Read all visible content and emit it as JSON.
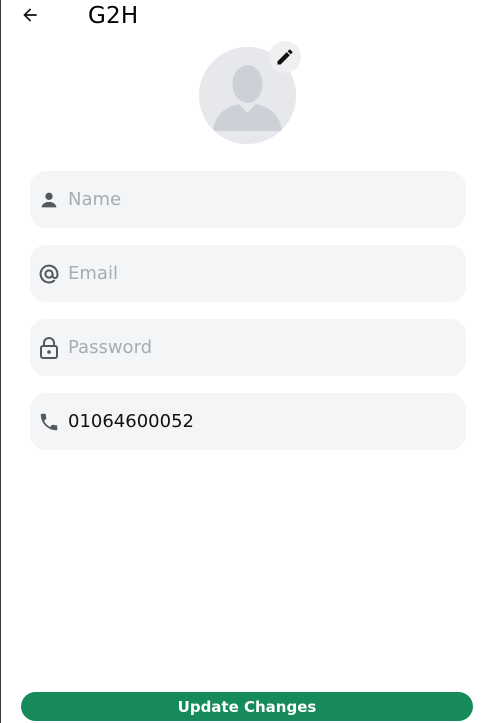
{
  "header": {
    "back_icon": "arrow-left-icon",
    "title": "G2H"
  },
  "profile": {
    "avatar_icon": "default-user-silhouette",
    "edit_icon": "pencil-icon"
  },
  "form": {
    "name": {
      "icon": "person-icon",
      "placeholder": "Name",
      "value": ""
    },
    "email": {
      "icon": "at-sign-icon",
      "placeholder": "Email",
      "value": ""
    },
    "password": {
      "icon": "lock-icon",
      "placeholder": "Password",
      "value": ""
    },
    "phone": {
      "icon": "phone-icon",
      "placeholder": "",
      "value": "01064600052"
    }
  },
  "actions": {
    "update_label": "Update Changes"
  },
  "colors": {
    "accent": "#168a5a",
    "field_bg": "#f4f5f7",
    "placeholder": "#a6abb5",
    "icon": "#55585e"
  }
}
